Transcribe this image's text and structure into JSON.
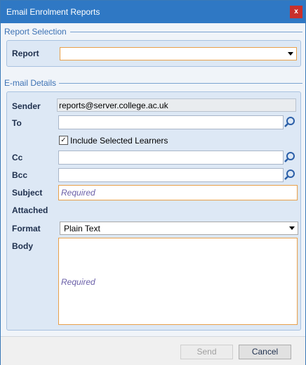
{
  "window": {
    "title": "Email Enrolment Reports",
    "close_label": "x"
  },
  "report_section": {
    "heading": "Report Selection",
    "report_label": "Report",
    "report_value": ""
  },
  "email_section": {
    "heading": "E-mail Details",
    "sender_label": "Sender",
    "sender_value": "reports@server.college.ac.uk",
    "to_label": "To",
    "to_value": "",
    "include_selected": {
      "label": "Include Selected Learners",
      "checked": true,
      "mark": "✓"
    },
    "cc_label": "Cc",
    "cc_value": "",
    "bcc_label": "Bcc",
    "bcc_value": "",
    "subject_label": "Subject",
    "subject_placeholder": "Required",
    "attached_label": "Attached",
    "format_label": "Format",
    "format_value": "Plain Text",
    "body_label": "Body",
    "body_placeholder": "Required"
  },
  "footer": {
    "send_label": "Send",
    "cancel_label": "Cancel"
  },
  "icons": {
    "search": "search-icon",
    "dropdown": "chevron-down-icon",
    "checkbox": "checkmark"
  },
  "colors": {
    "titlebar": "#2f78c4",
    "close": "#c9302c",
    "required_border": "#e8a04a",
    "panel": "#dde8f5"
  }
}
